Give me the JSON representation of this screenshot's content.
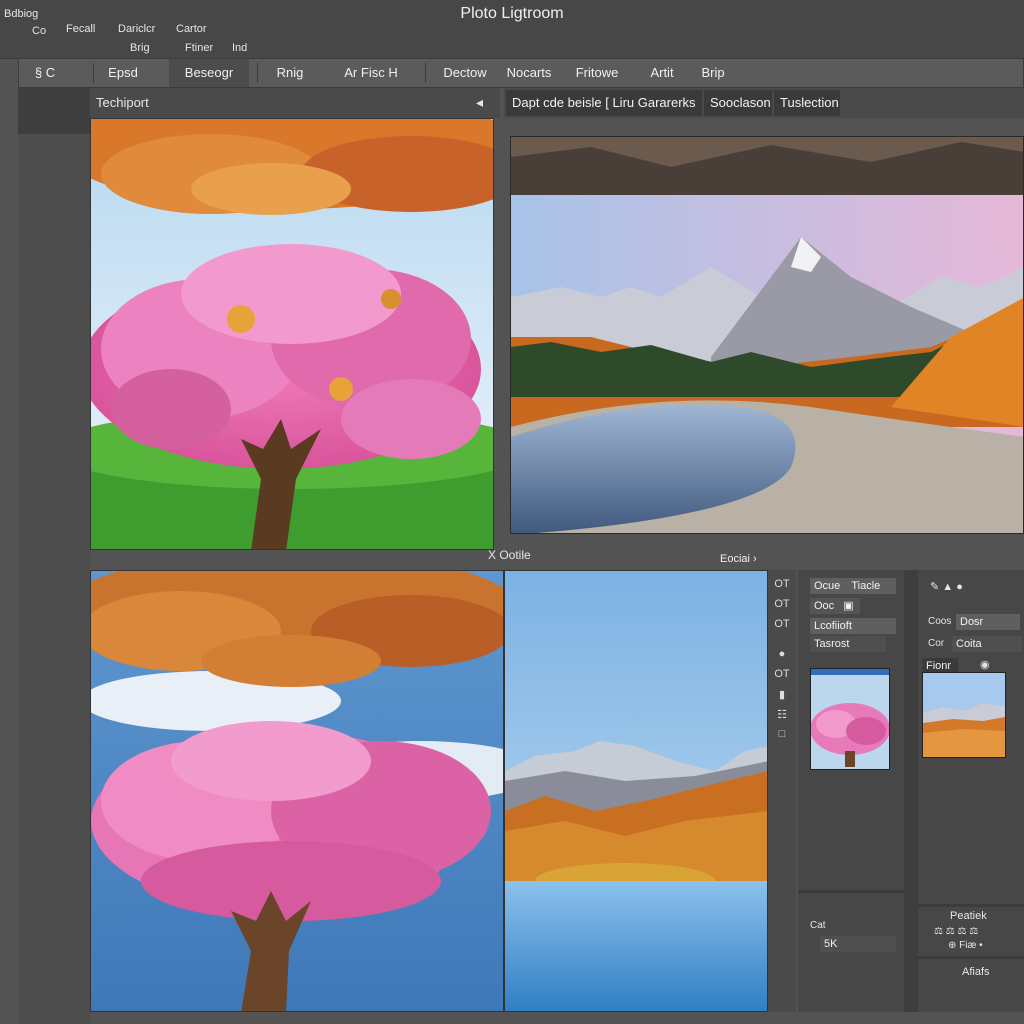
{
  "app": {
    "title": "Ploto Ligtroom"
  },
  "menubar": {
    "row1": [
      "Bdbiog"
    ],
    "row2": [
      "Co",
      "Fecall",
      "Dariclcr",
      "Cartor"
    ],
    "row3": [
      "Brig",
      "Ftiner",
      "Ind"
    ]
  },
  "toolbar": {
    "items": [
      "§ C",
      "Epsd",
      "Beseogr",
      "Rnig",
      "Ar Fisc H",
      "Dectow",
      "Nocarts",
      "Fritowe",
      "Artit",
      "Brip"
    ]
  },
  "left_panel": {
    "title": "Techiport",
    "collapse_icon": "chevron-left-icon",
    "collapse_label": "◂"
  },
  "right_header": {
    "tabs": [
      "Dapt cde beisle [ Liru Gararerks",
      "Sooclason",
      "Tuslection"
    ]
  },
  "overlays": {
    "left_label": "X Ootile",
    "right_label": "Eociai ›"
  },
  "panel_a": {
    "rows": [
      {
        "icon": "eye-icon",
        "glyph": "◉",
        "label": "Ocue",
        "value": "Tiacle"
      },
      {
        "icon": "lock-icon",
        "glyph": "▣",
        "label": "Ooc",
        "value": ""
      },
      {
        "icon": "",
        "glyph": "",
        "label": "",
        "value": "Lcofiioft"
      },
      {
        "icon": "",
        "glyph": "",
        "label": "",
        "value": "Tasrost"
      }
    ],
    "side_icons": [
      "OT",
      "OT",
      "OT",
      "OT"
    ],
    "bottom": {
      "label": "Cat",
      "value": "5K"
    }
  },
  "panel_b": {
    "rows": [
      {
        "label": "Coos",
        "value": "Dosr"
      },
      {
        "label": "Cor",
        "value": "Coita"
      }
    ],
    "thumb_label": "Fionr",
    "bottom": {
      "title": "Peatiek",
      "values": "⚖ ⚖ ⚖ ⚖",
      "value2": "⊕ Fiæ •",
      "footer": "Afiafs"
    }
  },
  "colors": {
    "background": "#535353",
    "panel": "#474747",
    "accent": "#2f6fb5"
  }
}
